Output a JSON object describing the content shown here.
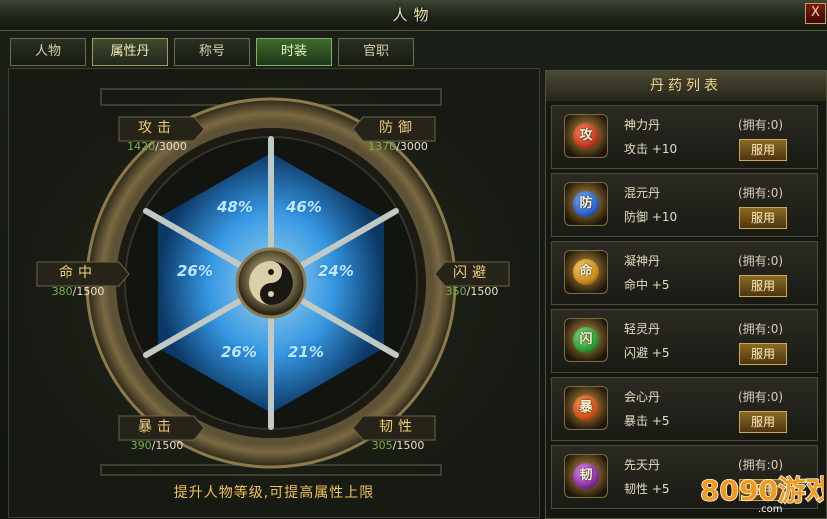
{
  "window": {
    "title": "人物",
    "close_label": "X"
  },
  "tabs": [
    {
      "label": "人物",
      "state": "normal"
    },
    {
      "label": "属性丹",
      "state": "active"
    },
    {
      "label": "称号",
      "state": "normal"
    },
    {
      "label": "时装",
      "state": "highlight"
    },
    {
      "label": "官职",
      "state": "normal"
    }
  ],
  "attributes": {
    "attack": {
      "label": "攻击",
      "current": "1420",
      "max": "/3000"
    },
    "defense": {
      "label": "防御",
      "current": "1370",
      "max": "/3000"
    },
    "hit": {
      "label": "命中",
      "current": "380",
      "max": "/1500"
    },
    "dodge": {
      "label": "闪避",
      "current": "350",
      "max": "/1500"
    },
    "crit": {
      "label": "暴击",
      "current": "390",
      "max": "/1500"
    },
    "tenacity": {
      "label": "韧性",
      "current": "305",
      "max": "/1500"
    }
  },
  "wheel": {
    "segments": [
      "48%",
      "46%",
      "24%",
      "21%",
      "26%",
      "26%"
    ],
    "colors": {
      "fill": "#39a9ff",
      "ring": "#5d5236",
      "spoke": "#c1c9c4"
    }
  },
  "tip": "提升人物等级,可提高属性上限",
  "pill_list": {
    "title": "丹药列表",
    "items": [
      {
        "icon_char": "攻",
        "name": "神力丹",
        "owned": "(拥有:0)",
        "stat": "攻击 +10",
        "button": "服用",
        "color": "#c0391f"
      },
      {
        "icon_char": "防",
        "name": "混元丹",
        "owned": "(拥有:0)",
        "stat": "防御 +10",
        "button": "服用",
        "color": "#2a63c9"
      },
      {
        "icon_char": "命",
        "name": "凝神丹",
        "owned": "(拥有:0)",
        "stat": "命中 +5",
        "button": "服用",
        "color": "#c78b18"
      },
      {
        "icon_char": "闪",
        "name": "轻灵丹",
        "owned": "(拥有:0)",
        "stat": "闪避 +5",
        "button": "服用",
        "color": "#2c9a34"
      },
      {
        "icon_char": "暴",
        "name": "会心丹",
        "owned": "(拥有:0)",
        "stat": "暴击 +5",
        "button": "服用",
        "color": "#c64d16"
      },
      {
        "icon_char": "韧",
        "name": "先天丹",
        "owned": "(拥有:0)",
        "stat": "韧性 +5",
        "button": "服用",
        "color": "#8a2fa3"
      }
    ]
  },
  "watermark": {
    "text": "8090游戏",
    "sub": "com"
  }
}
